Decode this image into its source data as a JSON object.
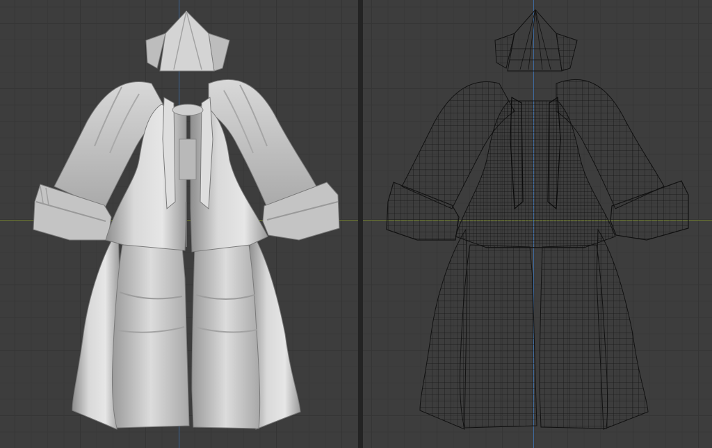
{
  "workspace": {
    "viewports": [
      {
        "name": "Solid",
        "shading": "solid"
      },
      {
        "name": "Wireframe",
        "shading": "wireframe"
      }
    ]
  },
  "colors": {
    "viewport_bg": "#3d3d3d",
    "grid_line": "#353535",
    "x_axis": "#7b8c2a",
    "z_axis": "#3f6fa7",
    "solid_mesh": "#c9c9c9",
    "wire_mesh": "#111111"
  },
  "model": {
    "object": "outfit-mesh",
    "icon": "coat-mesh-icon"
  }
}
